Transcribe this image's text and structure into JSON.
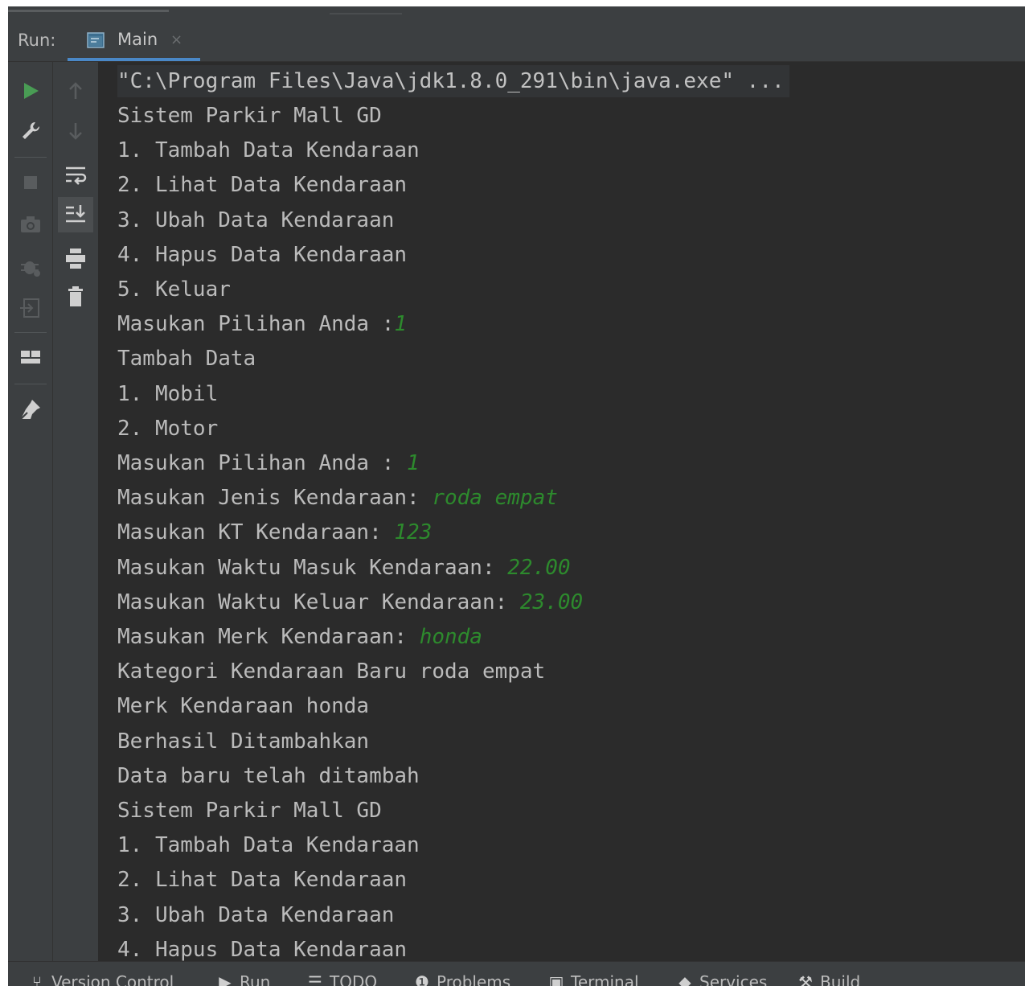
{
  "run_panel": {
    "label": "Run:",
    "tab": {
      "label": "Main",
      "close": "×"
    }
  },
  "colors": {
    "background": "#2b2b2b",
    "panel": "#3c3f41",
    "text": "#bbbbbb",
    "user_input": "#2d8a2d",
    "run_green": "#499c54",
    "tab_underline": "#4a88c7"
  },
  "toolbar_left": [
    "run-icon",
    "wrench-icon",
    "stop-icon",
    "camera-icon",
    "debug-icon",
    "exit-icon",
    "layout-icon",
    "pin-icon"
  ],
  "toolbar_right": [
    "arrow-up-icon",
    "arrow-down-icon",
    "soft-wrap-icon",
    "scroll-to-end-icon",
    "print-icon",
    "trash-icon"
  ],
  "console": {
    "command": "\"C:\\Program Files\\Java\\jdk1.8.0_291\\bin\\java.exe\" ...",
    "lines": [
      {
        "text": "Sistem Parkir Mall GD",
        "input": ""
      },
      {
        "text": "1. Tambah Data Kendaraan",
        "input": ""
      },
      {
        "text": "2. Lihat Data Kendaraan",
        "input": ""
      },
      {
        "text": "3. Ubah Data Kendaraan",
        "input": ""
      },
      {
        "text": "4. Hapus Data Kendaraan",
        "input": ""
      },
      {
        "text": "5. Keluar",
        "input": ""
      },
      {
        "text": "Masukan Pilihan Anda :",
        "input": "1"
      },
      {
        "text": "Tambah Data",
        "input": ""
      },
      {
        "text": "1. Mobil",
        "input": ""
      },
      {
        "text": "2. Motor",
        "input": ""
      },
      {
        "text": "Masukan Pilihan Anda : ",
        "input": "1"
      },
      {
        "text": "Masukan Jenis Kendaraan: ",
        "input": "roda empat"
      },
      {
        "text": "Masukan KT Kendaraan: ",
        "input": "123"
      },
      {
        "text": "Masukan Waktu Masuk Kendaraan: ",
        "input": "22.00"
      },
      {
        "text": "Masukan Waktu Keluar Kendaraan: ",
        "input": "23.00"
      },
      {
        "text": "Masukan Merk Kendaraan: ",
        "input": "honda"
      },
      {
        "text": "Kategori Kendaraan Baru roda empat",
        "input": ""
      },
      {
        "text": "Merk Kendaraan honda",
        "input": ""
      },
      {
        "text": "Berhasil Ditambahkan",
        "input": ""
      },
      {
        "text": "Data baru telah ditambah",
        "input": ""
      },
      {
        "text": "Sistem Parkir Mall GD",
        "input": ""
      },
      {
        "text": "1. Tambah Data Kendaraan",
        "input": ""
      },
      {
        "text": "2. Lihat Data Kendaraan",
        "input": ""
      },
      {
        "text": "3. Ubah Data Kendaraan",
        "input": ""
      },
      {
        "text": "4. Hapus Data Kendaraan",
        "input": ""
      }
    ]
  },
  "statusbar": {
    "items": [
      {
        "icon": "branch-icon",
        "label": "Version Control"
      },
      {
        "icon": "run-icon",
        "label": "Run"
      },
      {
        "icon": "list-icon",
        "label": "TODO"
      },
      {
        "icon": "problems-icon",
        "label": "Problems"
      },
      {
        "icon": "terminal-icon",
        "label": "Terminal"
      },
      {
        "icon": "services-icon",
        "label": "Services"
      },
      {
        "icon": "build-icon",
        "label": "Build"
      }
    ]
  }
}
